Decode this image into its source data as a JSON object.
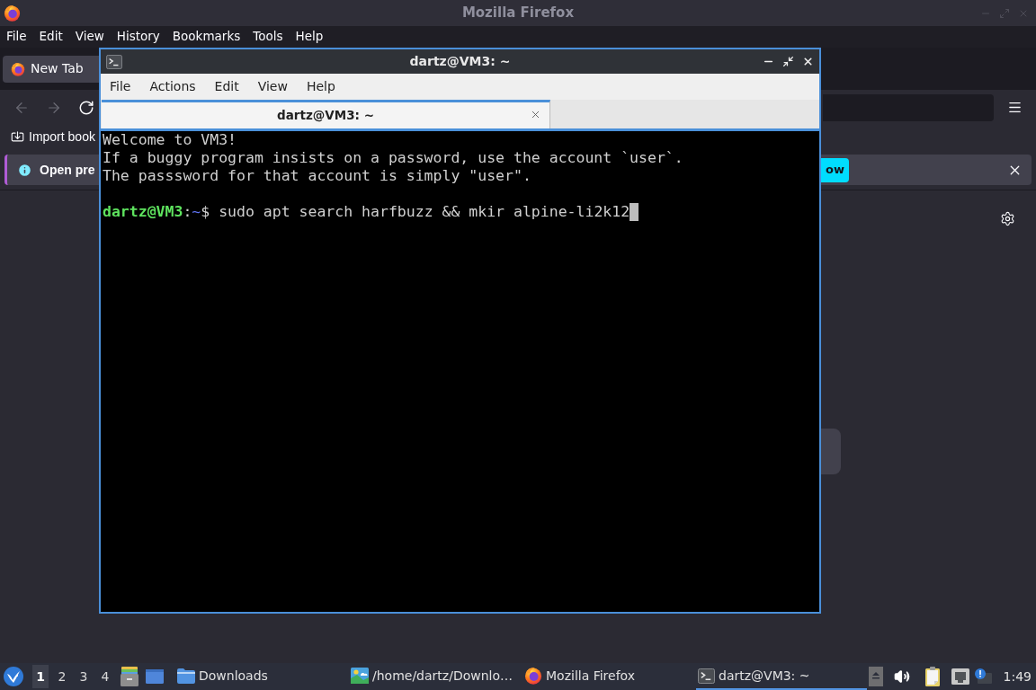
{
  "firefox": {
    "active": false,
    "title": "Mozilla Firefox",
    "menu": [
      "File",
      "Edit",
      "View",
      "History",
      "Bookmarks",
      "Tools",
      "Help"
    ],
    "tabs": [
      {
        "label": "New Tab",
        "selected": true
      }
    ],
    "nav": [
      {
        "kind": "back",
        "disabled": true
      },
      {
        "kind": "forward",
        "disabled": true
      },
      {
        "kind": "reload",
        "disabled": false
      }
    ],
    "bookmarks": [
      {
        "label": "Import book"
      }
    ],
    "notification": {
      "text": "Open pre",
      "button": "ow"
    }
  },
  "terminal": {
    "active": true,
    "title": "dartz@VM3: ~",
    "menu": [
      "File",
      "Actions",
      "Edit",
      "View",
      "Help"
    ],
    "tabs": [
      {
        "label": "dartz@VM3: ~",
        "selected": true
      }
    ],
    "lines": [
      "Welcome to VM3!",
      "If a buggy program insists on a password, use the account `user`.",
      "The passsword for that account is simply \"user\"."
    ],
    "prompt": {
      "user": "dartz@VM3",
      "separator": ":",
      "path": "~",
      "symbol": "$",
      "command": "sudo apt search harfbuzz && mkir alpine-li2k12"
    }
  },
  "taskbar": {
    "workspaces": [
      {
        "label": "1",
        "selected": true
      },
      {
        "label": "2",
        "selected": false
      },
      {
        "label": "3",
        "selected": false
      },
      {
        "label": "4",
        "selected": false
      }
    ],
    "tasks": [
      {
        "kind": "folder",
        "label": "Downloads",
        "selected": false
      },
      {
        "kind": "image",
        "label": "/home/dartz/Downlo…",
        "selected": false
      },
      {
        "kind": "browser",
        "label": "Mozilla Firefox",
        "selected": false
      },
      {
        "kind": "terminal",
        "label": "dartz@VM3: ~",
        "selected": true
      }
    ],
    "clock": "1:49"
  }
}
